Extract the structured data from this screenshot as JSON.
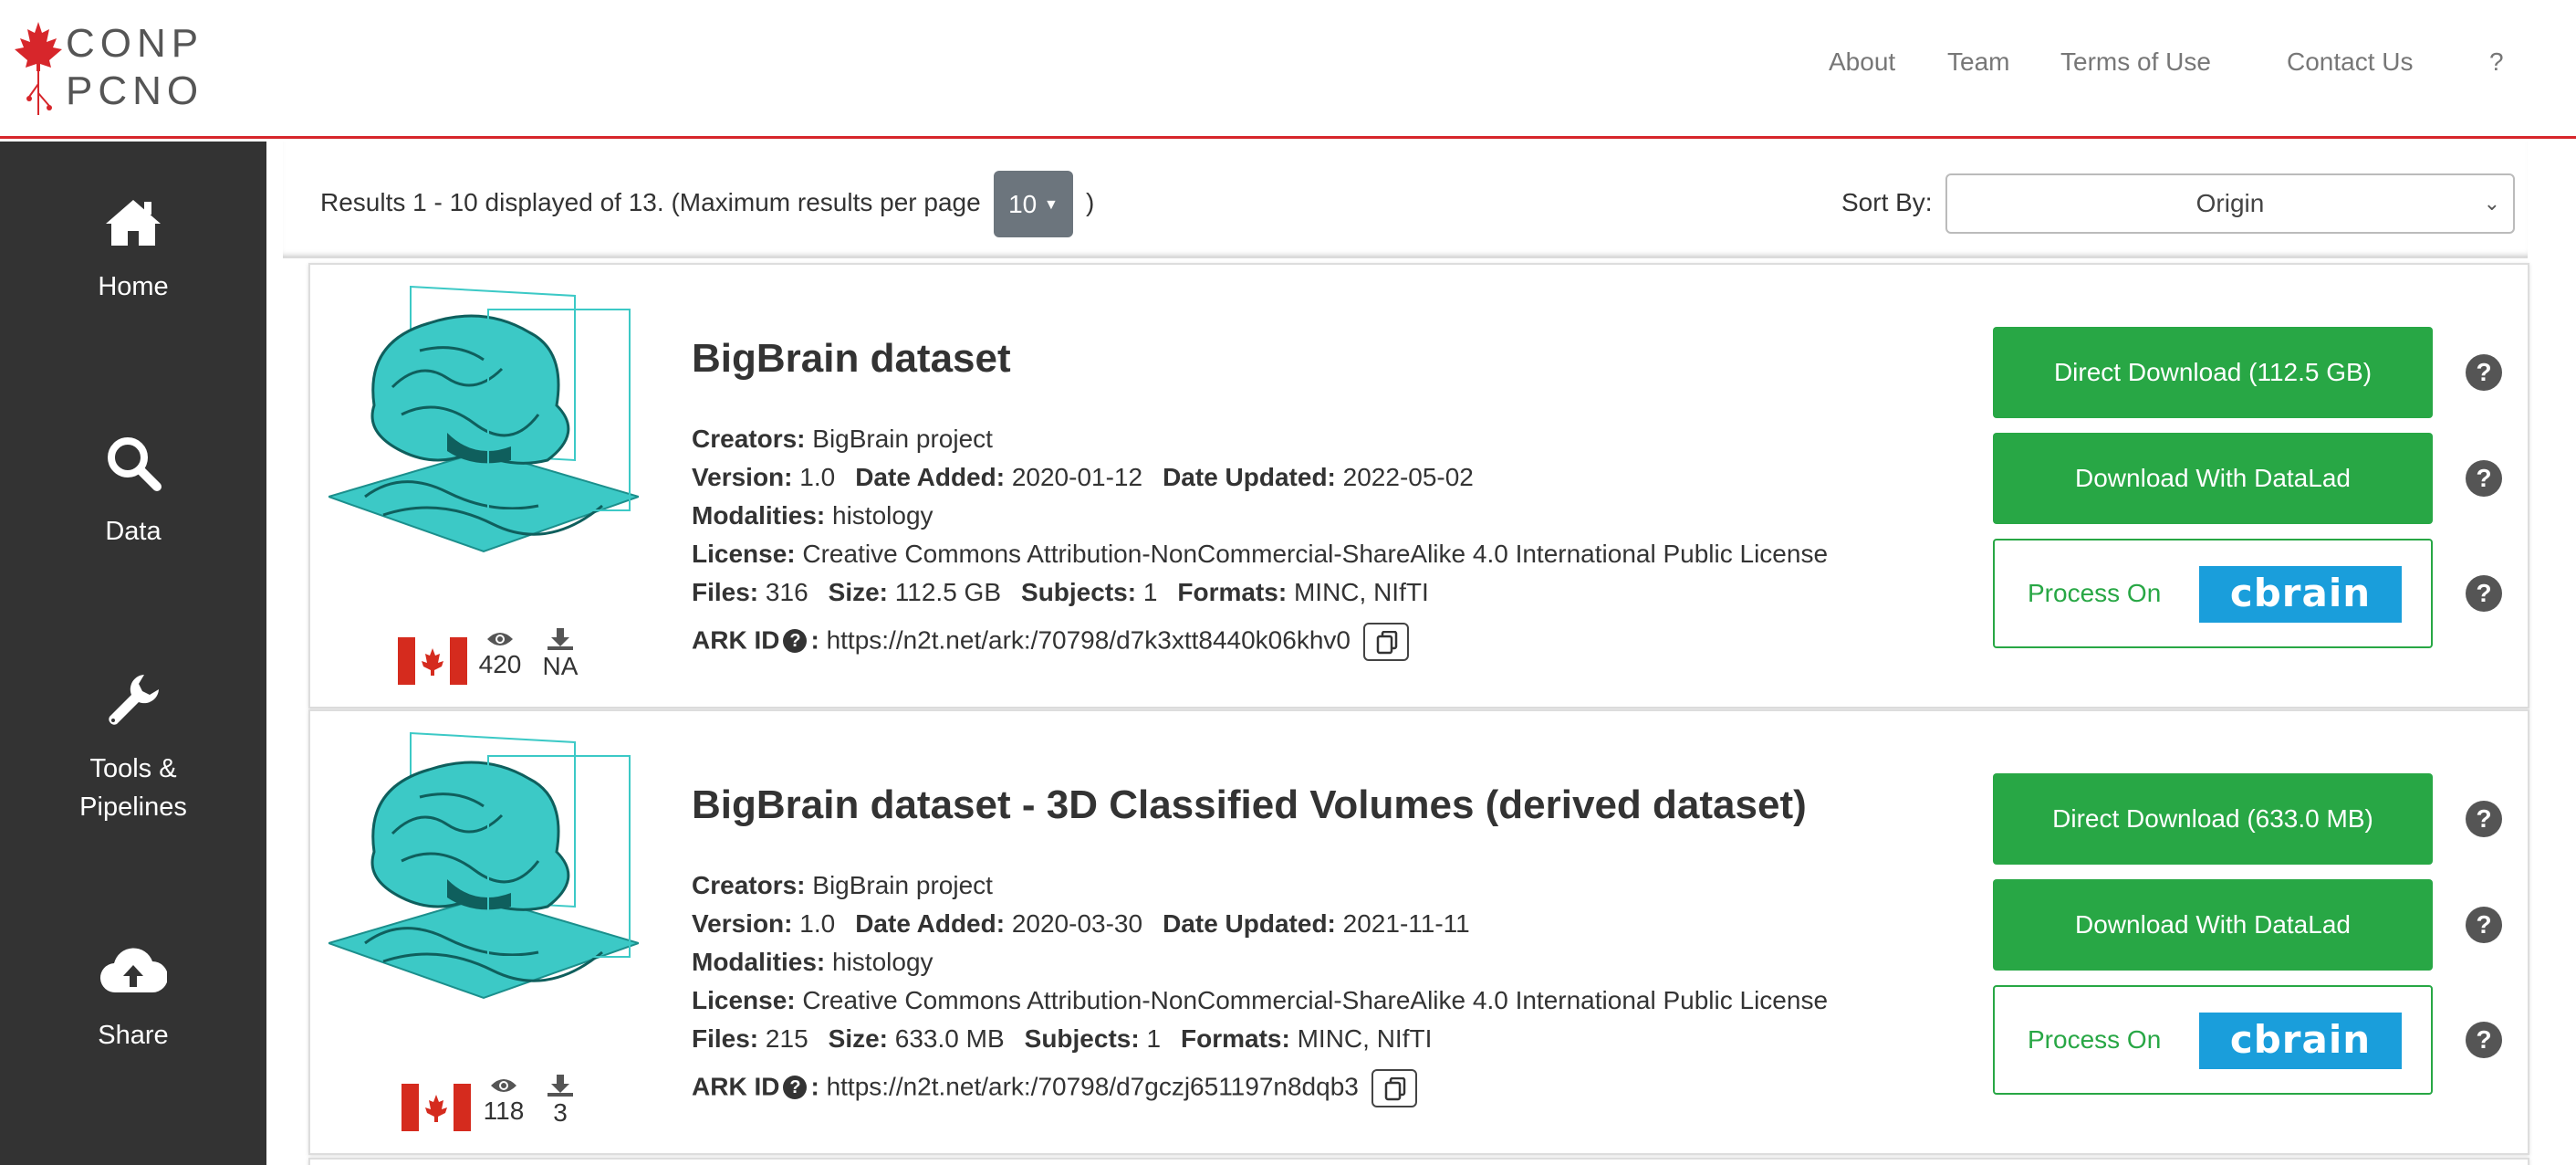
{
  "header": {
    "logo_line1": "CONP",
    "logo_line2": "PCNO",
    "nav": [
      "About",
      "Team",
      "Terms of Use",
      "Contact Us",
      "?"
    ]
  },
  "sidebar": {
    "items": [
      {
        "label": "Home",
        "icon": "home-icon"
      },
      {
        "label": "Data",
        "icon": "search-icon"
      },
      {
        "label_line1": "Tools &",
        "label_line2": "Pipelines",
        "icon": "wrench-icon"
      },
      {
        "label": "Share",
        "icon": "cloud-upload-icon"
      }
    ]
  },
  "results": {
    "text": "Results 1 - 10 displayed of 13. (Maximum results per page",
    "per_page": "10",
    "close_paren": ")",
    "sort_label": "Sort By:",
    "sort_value": "Origin"
  },
  "datasets": [
    {
      "title": "BigBrain dataset",
      "creators": "BigBrain project",
      "version": "1.0",
      "date_added": "2020-01-12",
      "date_updated": "2022-05-02",
      "modalities": "histology",
      "license": "Creative Commons Attribution-NonCommercial-ShareAlike 4.0 International Public License",
      "files": "316",
      "size": "112.5 GB",
      "subjects": "1",
      "formats": "MINC, NIfTI",
      "ark": "https://n2t.net/ark:/70798/d7k3xtt8440k06khv0",
      "views": "420",
      "downloads": "NA",
      "direct_download": "Direct Download (112.5 GB)",
      "datalad": "Download With DataLad",
      "process_on": "Process On",
      "cbrain": "cbrain"
    },
    {
      "title": "BigBrain dataset - 3D Classified Volumes (derived dataset)",
      "creators": "BigBrain project",
      "version": "1.0",
      "date_added": "2020-03-30",
      "date_updated": "2021-11-11",
      "modalities": "histology",
      "license": "Creative Commons Attribution-NonCommercial-ShareAlike 4.0 International Public License",
      "files": "215",
      "size": "633.0 MB",
      "subjects": "1",
      "formats": "MINC, NIfTI",
      "ark": "https://n2t.net/ark:/70798/d7gczj651197n8dqb3",
      "views": "118",
      "downloads": "3",
      "direct_download": "Direct Download (633.0 MB)",
      "datalad": "Download With DataLad",
      "process_on": "Process On",
      "cbrain": "cbrain"
    }
  ],
  "labels": {
    "creators": "Creators:",
    "version": "Version:",
    "date_added": "Date Added:",
    "date_updated": "Date Updated:",
    "modalities": "Modalities:",
    "license": "License:",
    "files": "Files:",
    "size": "Size:",
    "subjects": "Subjects:",
    "formats": "Formats:",
    "ark": "ARK ID",
    "ark_colon": ":",
    "help": "?"
  },
  "colors": {
    "accent_red": "#d7262b",
    "sidebar_bg": "#333333",
    "button_green": "#28a745",
    "cbrain_blue": "#1a9edb",
    "brain_cyan": "#3cc9c6"
  }
}
